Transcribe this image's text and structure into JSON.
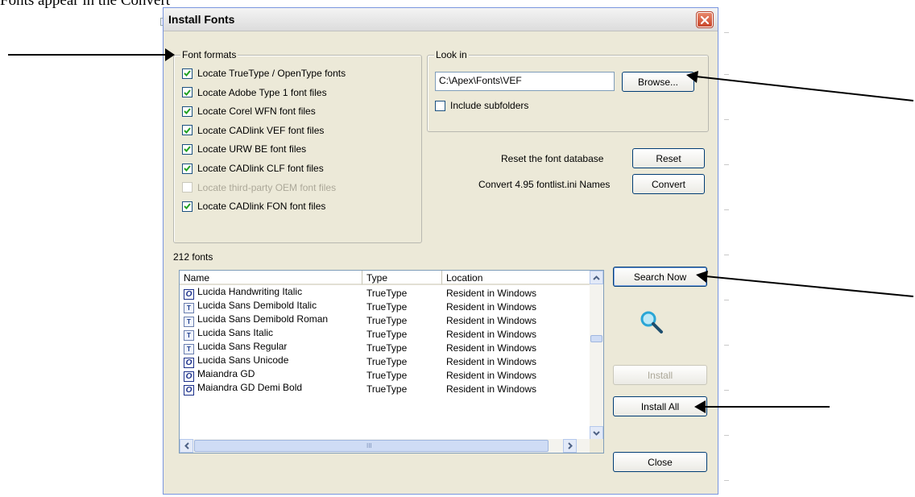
{
  "document": {
    "snippet": "Fonts appear in the Convert window as."
  },
  "dialog": {
    "title": "Install Fonts",
    "font_formats": {
      "legend": "Font formats",
      "items": [
        {
          "label": "Locate TrueType / OpenType fonts",
          "checked": true,
          "enabled": true
        },
        {
          "label": "Locate Adobe Type 1 font files",
          "checked": true,
          "enabled": true
        },
        {
          "label": "Locate Corel WFN font files",
          "checked": true,
          "enabled": true
        },
        {
          "label": "Locate CADlink VEF font files",
          "checked": true,
          "enabled": true
        },
        {
          "label": "Locate URW BE font files",
          "checked": true,
          "enabled": true
        },
        {
          "label": "Locate CADlink CLF font files",
          "checked": true,
          "enabled": true
        },
        {
          "label": "Locate third-party OEM font files",
          "checked": false,
          "enabled": false
        },
        {
          "label": "Locate CADlink FON font files",
          "checked": true,
          "enabled": true
        }
      ]
    },
    "look_in": {
      "legend": "Look in",
      "path_value": "C:\\Apex\\Fonts\\VEF",
      "browse_label": "Browse...",
      "include_subfolders_label": "Include subfolders",
      "include_subfolders_checked": false
    },
    "reset": {
      "text": "Reset the font database",
      "button": "Reset"
    },
    "convert": {
      "text": "Convert 4.95 fontlist.ini Names",
      "button": "Convert"
    },
    "font_count": "212 fonts",
    "list": {
      "columns": [
        "Name",
        "Type",
        "Location"
      ],
      "rows": [
        {
          "icon": "opentype-icon",
          "name": "Lucida Handwriting Italic",
          "type": "TrueType",
          "location": "Resident in Windows"
        },
        {
          "icon": "truetype-icon",
          "name": "Lucida Sans Demibold Italic",
          "type": "TrueType",
          "location": "Resident in Windows"
        },
        {
          "icon": "truetype-icon",
          "name": "Lucida Sans Demibold Roman",
          "type": "TrueType",
          "location": "Resident in Windows"
        },
        {
          "icon": "truetype-icon",
          "name": "Lucida Sans Italic",
          "type": "TrueType",
          "location": "Resident in Windows"
        },
        {
          "icon": "truetype-icon",
          "name": "Lucida Sans Regular",
          "type": "TrueType",
          "location": "Resident in Windows"
        },
        {
          "icon": "opentype-icon",
          "name": "Lucida Sans Unicode",
          "type": "TrueType",
          "location": "Resident in Windows"
        },
        {
          "icon": "opentype-icon",
          "name": "Maiandra GD",
          "type": "TrueType",
          "location": "Resident in Windows"
        },
        {
          "icon": "opentype-icon",
          "name": "Maiandra GD Demi Bold",
          "type": "TrueType",
          "location": "Resident in Windows"
        }
      ]
    },
    "buttons": {
      "search_now": "Search Now",
      "install": "Install",
      "install_all": "Install All",
      "close": "Close"
    },
    "icons": {
      "search_glass_color": "#2aa6d6"
    }
  }
}
